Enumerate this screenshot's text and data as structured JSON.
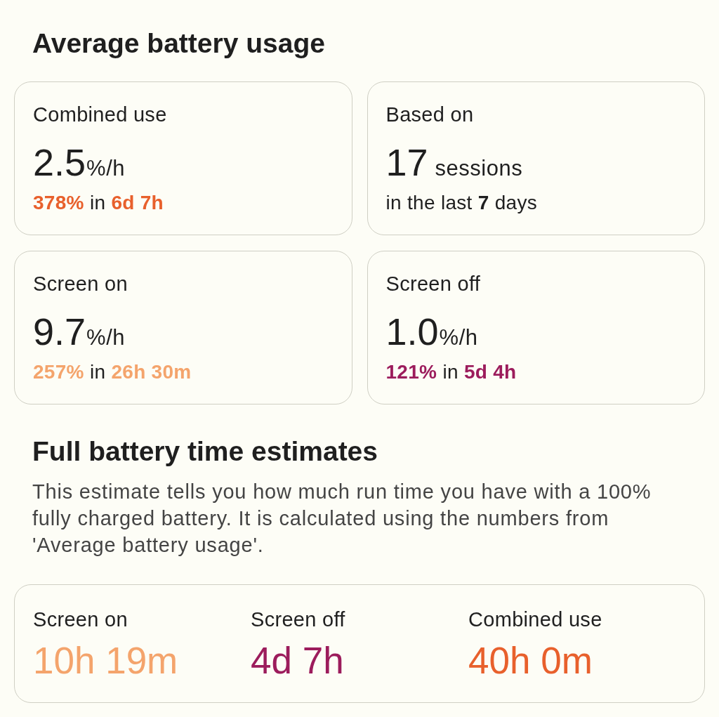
{
  "average_usage": {
    "title": "Average battery usage",
    "cards": [
      {
        "label": "Combined use",
        "value": "2.5",
        "unit": "%/h",
        "kind": "rate",
        "detail": "**378%** in **6d 7h**",
        "color": "#e8602c"
      },
      {
        "label": "Based on",
        "value": "17",
        "unit": "sessions",
        "kind": "count",
        "detail": "in the last **7** days"
      },
      {
        "label": "Screen on",
        "value": "9.7",
        "unit": "%/h",
        "kind": "rate",
        "detail": "**257%** in **26h 30m**",
        "color": "#f4a46c"
      },
      {
        "label": "Screen off",
        "value": "1.0",
        "unit": "%/h",
        "kind": "rate",
        "detail": "**121%** in **5d 4h**",
        "color": "#9c1c5c"
      }
    ]
  },
  "estimates": {
    "title": "Full battery time estimates",
    "description": "This estimate tells you how much run time you have with a 100% fully charged battery. It is calculated using the numbers from 'Average battery usage'.",
    "items": [
      {
        "label": "Screen on",
        "value": "10h 19m",
        "color": "#f4a46c"
      },
      {
        "label": "Screen off",
        "value": "4d 7h",
        "color": "#9c1c5c"
      },
      {
        "label": "Combined use",
        "value": "40h 0m",
        "color": "#e8602c"
      }
    ]
  }
}
